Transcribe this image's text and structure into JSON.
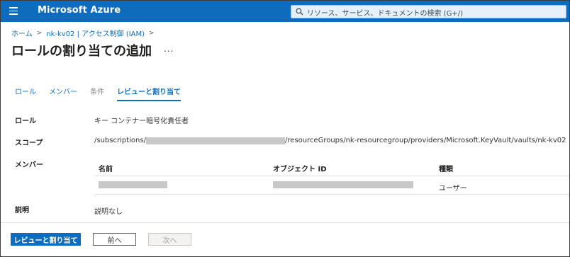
{
  "header": {
    "brand": "Microsoft Azure",
    "search_placeholder": "リソース、サービス、ドキュメントの検索 (G+/)"
  },
  "breadcrumb": {
    "items": [
      "ホーム",
      "nk-kv02 | アクセス制御 (IAM)"
    ]
  },
  "page": {
    "title": "ロールの割り当ての追加",
    "more": "..."
  },
  "tabs": [
    {
      "label": "ロール",
      "state": "link"
    },
    {
      "label": "メンバー",
      "state": "link"
    },
    {
      "label": "条件",
      "state": "disabled"
    },
    {
      "label": "レビューと割り当て",
      "state": "active"
    }
  ],
  "review": {
    "role_label": "ロール",
    "role_value": "キー コンテナー暗号化責任者",
    "scope_label": "スコープ",
    "scope_prefix": "/subscriptions/",
    "scope_suffix": "/resourceGroups/nk-resourcegroup/providers/Microsoft.KeyVault/vaults/nk-kv02",
    "members_label": "メンバー",
    "description_label": "説明",
    "description_value": "説明なし"
  },
  "members_table": {
    "columns": [
      "名前",
      "オブジェクト ID",
      "種類"
    ],
    "rows": [
      {
        "name": "",
        "object_id": "",
        "type": "ユーザー"
      }
    ]
  },
  "footer": {
    "primary": "レビューと割り当て",
    "previous": "前へ",
    "next": "次へ"
  },
  "colors": {
    "accent": "#0f6cbd",
    "redaction": "#c8c8c8"
  }
}
